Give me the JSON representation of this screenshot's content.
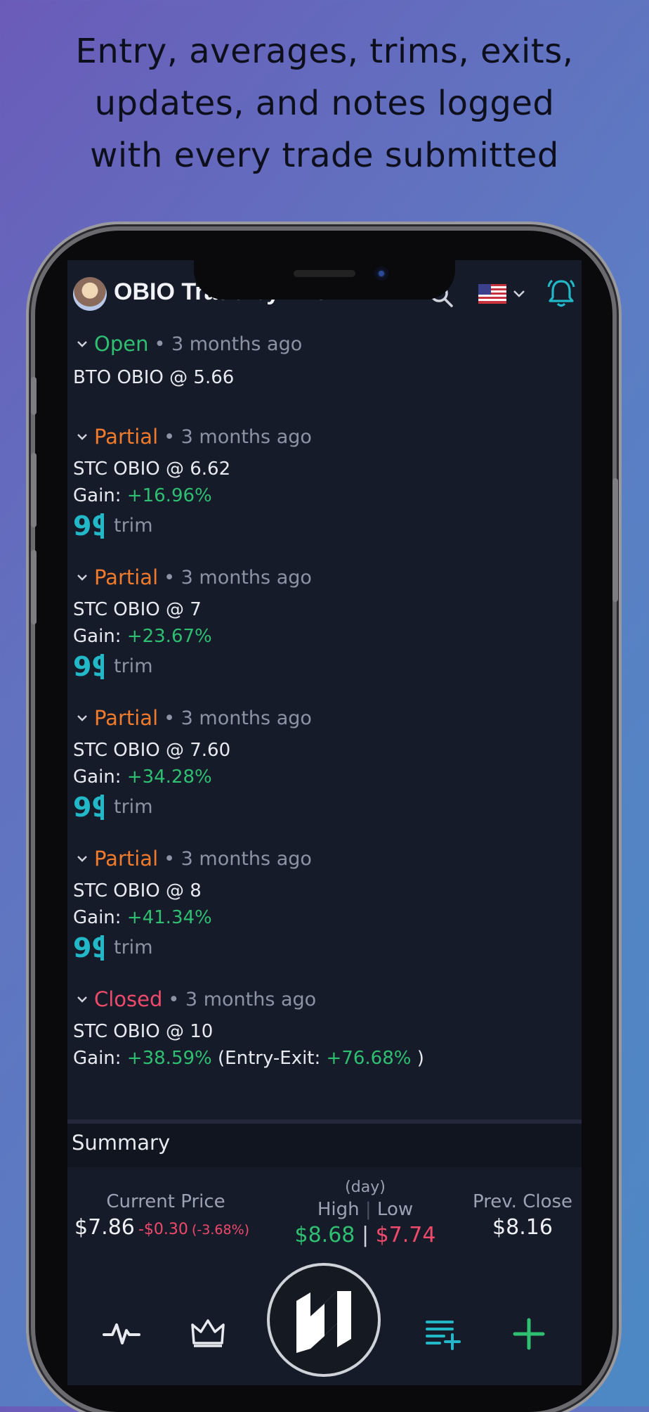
{
  "headline": [
    "Entry, averages, trims, exits,",
    "updates, and notes logged",
    "with every trade submitted"
  ],
  "header": {
    "title": "OBIO Trade by Lilo",
    "flag": "us-flag-icon"
  },
  "entries": [
    {
      "status": "Open",
      "time": "• 3 months ago",
      "action": "BTO OBIO @ 5.66"
    },
    {
      "status": "Partial",
      "time": "• 3 months ago",
      "action": "STC OBIO @ 6.62",
      "gain_label": "Gain:",
      "gain": "+16.96%",
      "note": "trim"
    },
    {
      "status": "Partial",
      "time": "• 3 months ago",
      "action": "STC OBIO @ 7",
      "gain_label": "Gain:",
      "gain": "+23.67%",
      "note": "trim"
    },
    {
      "status": "Partial",
      "time": "• 3 months ago",
      "action": "STC OBIO @ 7.60",
      "gain_label": "Gain:",
      "gain": "+34.28%",
      "note": "trim"
    },
    {
      "status": "Partial",
      "time": "• 3 months ago",
      "action": "STC OBIO @ 8",
      "gain_label": "Gain:",
      "gain": "+41.34%",
      "note": "trim"
    },
    {
      "status": "Closed",
      "time": "• 3 months ago",
      "action": "STC OBIO @ 10",
      "gain_label": "Gain:",
      "gain": "+38.59%",
      "extra_open": "(Entry-Exit:",
      "extra_gain": "+76.68%",
      "extra_close": ")"
    }
  ],
  "summary": {
    "title": "Summary",
    "current_price_label": "Current Price",
    "current_price": "$7.86",
    "change": "-$0.30",
    "change_pct": "(-3.68%)",
    "day_label": "(day)",
    "high_label": "High",
    "low_label": "Low",
    "high": "$8.68",
    "low": "$7.74",
    "sep": "|",
    "prev_close_label": "Prev. Close",
    "prev_close": "$8.16"
  },
  "colors": {
    "open": "#2fbf71",
    "partial": "#f27a2c",
    "closed": "#ef4a6b",
    "accent": "#22b8c8"
  }
}
